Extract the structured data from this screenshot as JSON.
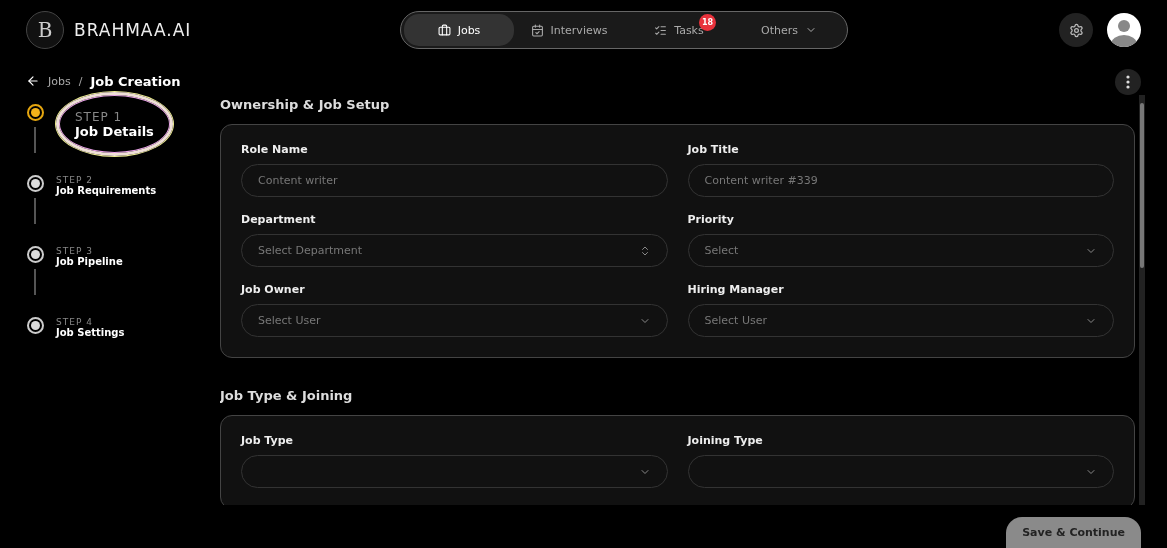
{
  "brand": {
    "name": "BRAHMAA.AI",
    "monogram": "B"
  },
  "nav": [
    {
      "label": "Jobs",
      "kind": "tab",
      "selected": true
    },
    {
      "label": "Interviews",
      "kind": "tab",
      "selected": false
    },
    {
      "label": "Tasks",
      "kind": "tab",
      "selected": false,
      "badge": "18"
    },
    {
      "label": "Others",
      "kind": "dropdown",
      "selected": false
    }
  ],
  "breadcrumb": {
    "parent": "Jobs",
    "separator": "/",
    "current": "Job Creation"
  },
  "steps": [
    {
      "step": "STEP 1",
      "title": "Job Details",
      "selected": true
    },
    {
      "step": "STEP 2",
      "title": "Job Requirements",
      "selected": false
    },
    {
      "step": "STEP 3",
      "title": "Job Pipeline",
      "selected": false
    },
    {
      "step": "STEP 4",
      "title": "Job Settings",
      "selected": false
    }
  ],
  "sections": [
    {
      "title": "Ownership & Job Setup",
      "fields": [
        {
          "label": "Role Name",
          "kind": "text",
          "placeholder": "Content writer"
        },
        {
          "label": "Job Title",
          "kind": "text",
          "placeholder": "Content writer #339"
        },
        {
          "label": "Department",
          "kind": "combo",
          "placeholder": "Select Department"
        },
        {
          "label": "Priority",
          "kind": "select",
          "placeholder": "Select"
        },
        {
          "label": "Job Owner",
          "kind": "select",
          "placeholder": "Select User"
        },
        {
          "label": "Hiring Manager",
          "kind": "select",
          "placeholder": "Select User"
        }
      ]
    },
    {
      "title": "Job Type & Joining",
      "fields": [
        {
          "label": "Job Type",
          "kind": "select"
        },
        {
          "label": "Joining Type",
          "kind": "select"
        }
      ]
    }
  ],
  "footer": {
    "button": "Save & Continue"
  }
}
